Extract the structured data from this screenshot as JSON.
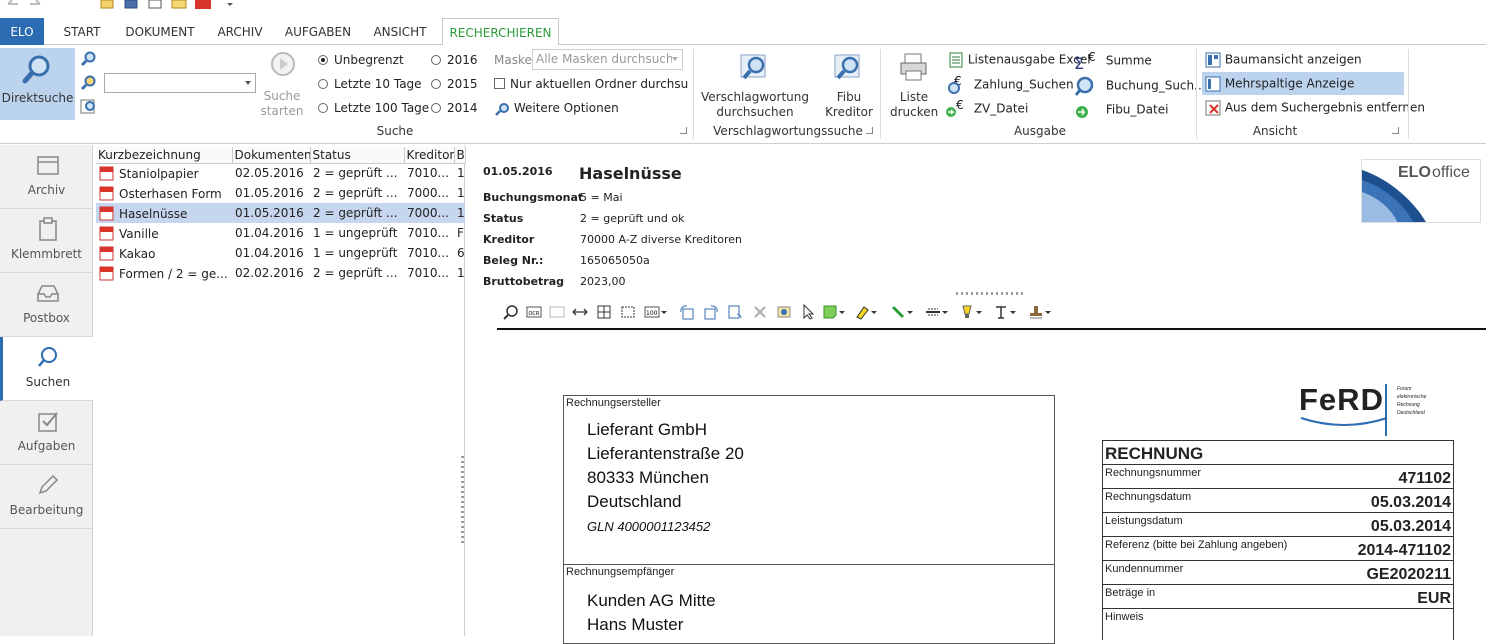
{
  "tabs": {
    "elo": "ELO",
    "start": "START",
    "dokument": "DOKUMENT",
    "archiv": "ARCHIV",
    "aufgaben": "AUFGABEN",
    "ansicht": "ANSICHT",
    "recherchieren": "RECHERCHIEREN"
  },
  "ribbon": {
    "direktsuche": "Direktsuche",
    "suche_starten_1": "Suche",
    "suche_starten_2": "starten",
    "radio": {
      "unbegrenzt": "Unbegrenzt",
      "letzte10": "Letzte 10 Tage",
      "letzte100": "Letzte 100 Tage",
      "y2016": "2016",
      "y2015": "2015",
      "y2014": "2014"
    },
    "maske_label": "Maske",
    "maske_value": "Alle Masken durchsuchen",
    "nur_ordner": "Nur aktuellen Ordner durchsuchen",
    "weitere_optionen": "Weitere Optionen",
    "group_suche": "Suche",
    "verschlag_1": "Verschlagwortung",
    "verschlag_2": "durchsuchen",
    "fibu_1": "Fibu",
    "fibu_2": "Kreditor",
    "group_verschlag": "Verschlagwortungssuche",
    "liste_1": "Liste",
    "liste_2": "drucken",
    "listenausgabe_excel": "Listenausgabe Excel",
    "zahlung_suchen": "Zahlung_Suchen",
    "zv_datei": "ZV_Datei",
    "summe": "Summe",
    "buchung_such": "Buchung_Such...",
    "fibu_datei": "Fibu_Datei",
    "group_ausgabe": "Ausgabe",
    "baumansicht": "Baumansicht anzeigen",
    "mehrspaltige": "Mehrspaltige Anzeige",
    "aus_suchergebnis": "Aus dem Suchergebnis entfernen",
    "group_ansicht": "Ansicht"
  },
  "nav": {
    "archiv": "Archiv",
    "klemmbrett": "Klemmbrett",
    "postbox": "Postbox",
    "suchen": "Suchen",
    "aufgaben": "Aufgaben",
    "bearbeitung": "Bearbeitung"
  },
  "list": {
    "headers": [
      "Kurzbezeichnung",
      "Dokumentend",
      "Status",
      "Kreditor",
      "B"
    ],
    "rows": [
      {
        "name": "Staniolpapier",
        "date": "02.05.2016",
        "status": "2 = geprüft ...",
        "kreditor": "7010...",
        "extra": "1"
      },
      {
        "name": "Osterhasen Form",
        "date": "01.05.2016",
        "status": "2 = geprüft ...",
        "kreditor": "7000...",
        "extra": "1"
      },
      {
        "name": "Haselnüsse",
        "date": "01.05.2016",
        "status": "2 = geprüft ...",
        "kreditor": "7000...",
        "extra": "1"
      },
      {
        "name": "Vanille",
        "date": "01.04.2016",
        "status": "1 = ungeprüft",
        "kreditor": "7010...",
        "extra": "F"
      },
      {
        "name": "Kakao",
        "date": "01.04.2016",
        "status": "1 = ungeprüft",
        "kreditor": "7010...",
        "extra": "6"
      },
      {
        "name": "Formen / 2 = ge...",
        "date": "02.02.2016",
        "status": "2 = geprüft ...",
        "kreditor": "7010...",
        "extra": "1"
      }
    ]
  },
  "detail": {
    "date": "01.05.2016",
    "title": "Haselnüsse",
    "fields": [
      {
        "label": "Buchungsmonat",
        "value": "5 = Mai"
      },
      {
        "label": "Status",
        "value": "2 = geprüft und ok"
      },
      {
        "label": "Kreditor",
        "value": "70000 A-Z diverse Kreditoren"
      },
      {
        "label": "Beleg Nr.:",
        "value": "165065050a"
      },
      {
        "label": "Bruttobetrag",
        "value": "2023,00"
      }
    ],
    "logo_elo": "ELO",
    "logo_office": "office"
  },
  "document": {
    "ersteller_caption": "Rechnungsersteller",
    "ersteller_lines": [
      "Lieferant GmbH",
      "Lieferantenstraße 20",
      "80333 München",
      "Deutschland"
    ],
    "ersteller_gln": "GLN 4000001123452",
    "empfaenger_caption": "Rechnungsempfänger",
    "empfaenger_lines": [
      "Kunden AG Mitte",
      "Hans Muster"
    ],
    "ferd_logo": "FeRD",
    "ferd_sub": [
      "Forum",
      "elektronische",
      "Rechnung",
      "Deutschland"
    ],
    "rechnung_title": "RECHNUNG",
    "rechnung_rows": [
      {
        "key": "Rechnungsnummer",
        "value": "471102"
      },
      {
        "key": "Rechnungsdatum",
        "value": "05.03.2014"
      },
      {
        "key": "Leistungsdatum",
        "value": "05.03.2014"
      },
      {
        "key": "Referenz (bitte bei Zahlung angeben)",
        "value": "2014-471102"
      },
      {
        "key": "Kundennummer",
        "value": "GE2020211"
      },
      {
        "key": "Beträge in",
        "value": "EUR"
      },
      {
        "key": "Hinweis",
        "value": ""
      }
    ]
  },
  "colors": {
    "accent": "#2b6cb3",
    "active_tab_text": "#2b9a3a",
    "selection": "#c5d6ee"
  }
}
